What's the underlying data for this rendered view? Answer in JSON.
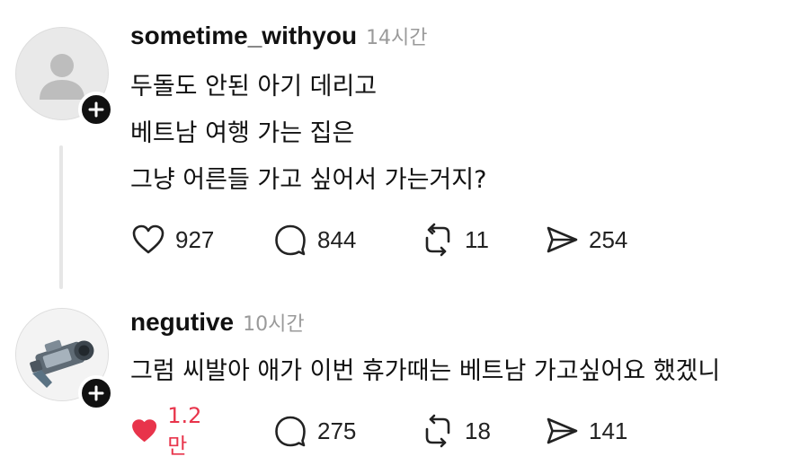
{
  "posts": [
    {
      "username": "sometime_withyou",
      "time": "14시간",
      "lines": [
        "두돌도 안된 아기 데리고",
        "베트남 여행 가는 집은",
        "그냥 어른들 가고 싶어서 가는거지?"
      ],
      "likes": "927",
      "comments": "844",
      "reposts": "11",
      "shares": "254",
      "liked": false,
      "avatar": "default-person-icon"
    },
    {
      "username": "negutive",
      "time": "10시간",
      "lines": [
        "그럼 씨발아 애가 이번 휴가때는 베트남 가고싶어요 했겠니"
      ],
      "likes": "1.2만",
      "comments": "275",
      "reposts": "18",
      "shares": "141",
      "liked": true,
      "avatar": "camcorder-image"
    }
  ],
  "colors": {
    "liked": "#e8344b",
    "muted": "#9a9a9a",
    "text": "#111111",
    "line": "#e6e6e6"
  }
}
